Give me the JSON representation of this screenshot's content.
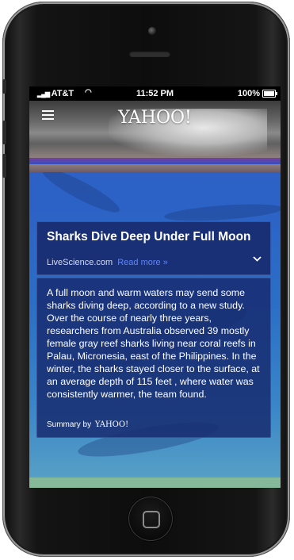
{
  "status_bar": {
    "carrier": "AT&T",
    "time": "11:52 PM",
    "battery": "100%"
  },
  "header": {
    "logo": "YAHOO!"
  },
  "article": {
    "title": "Sharks Dive Deep Under Full Moon",
    "source": "LiveScience.com",
    "read_more": "Read more »",
    "summary": "A full moon and warm waters may send some sharks diving deep, according to a new study. Over the course of nearly three years, researchers from Australia observed 39 mostly female gray reef sharks living near coral reefs in Palau, Micronesia, east of the Philippines. In the winter, the sharks stayed closer to the surface, at an average depth of 115 feet , where water was consistently warmer, the team found.",
    "summary_by": "Summary by",
    "summary_logo": "YAHOO!"
  },
  "icons": {
    "menu": "hamburger-menu-icon",
    "expand": "chevron-down-icon",
    "home": "home-button"
  },
  "colors": {
    "link": "#5d86ff",
    "card": "#182b70"
  }
}
